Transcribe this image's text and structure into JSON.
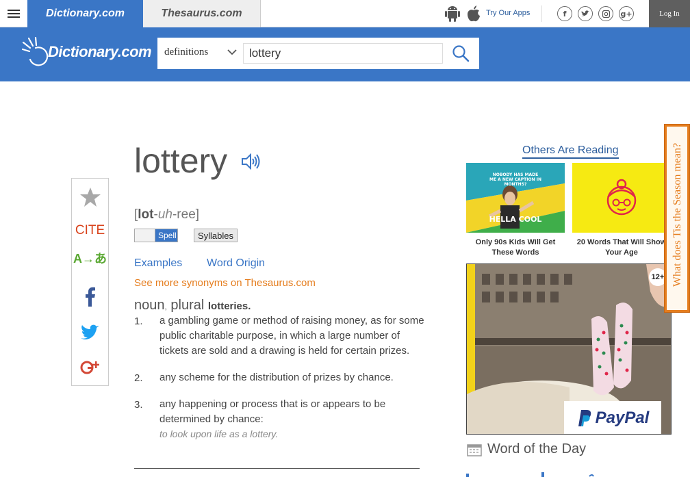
{
  "topbar": {
    "dictionary_tab": "Dictionary.com",
    "thesaurus_tab": "Thesaurus.com",
    "try_apps": "Try Our Apps",
    "login": "Log In",
    "social_icons": [
      "facebook-icon",
      "twitter-icon",
      "instagram-icon",
      "google-plus-icon"
    ]
  },
  "header": {
    "logo_text": "Dictionary.com",
    "search_mode": "definitions",
    "search_value": "lottery"
  },
  "rail": {
    "cite": "CITE",
    "translate": "A→あ"
  },
  "entry": {
    "headword": "lottery",
    "pron_stressed": "lot",
    "pron_dash1": "-",
    "pron_unstressed": "uh",
    "pron_dash2": "-",
    "pron_end": "ree",
    "spell_label": "Spell",
    "syllables_label": "Syllables",
    "tab_examples": "Examples",
    "tab_word_origin": "Word Origin",
    "synonyms_link": "See more synonyms on Thesaurus.com",
    "pos": "noun",
    "comma": ",",
    "plural_word": "plural",
    "plural_form": "lotteries.",
    "definitions": [
      {
        "num": "1.",
        "text": "a gambling game or method of raising money, as for some public charitable purpose, in which a large number of tickets are sold and a drawing is held for certain prizes."
      },
      {
        "num": "2.",
        "text": "any scheme for the distribution of prizes by chance."
      },
      {
        "num": "3.",
        "text": "any happening or process that is or appears to be determined by chance:",
        "example": "to look upon life as a lottery."
      }
    ]
  },
  "sidebar": {
    "others_title": "Others Are Reading",
    "thumb1_caption": "Only 90s Kids Will Get These Words",
    "thumb1_meme_top": "NOBODY HAS MADE ME A NEW CAPTION IN MONTHS?",
    "thumb1_meme_bottom": "HELLA COOL",
    "thumb2_caption": "20 Words That Will Show Your Age",
    "ad_brand": "PayPal",
    "ad_rating": "12+",
    "wotd_label": "Word of the Day"
  },
  "side_tab": {
    "label": "What does Tis the Season mean?"
  },
  "colors": {
    "brand_blue": "#3a76c6",
    "accent_orange": "#e57d1e",
    "cite_red": "#d9431c"
  }
}
